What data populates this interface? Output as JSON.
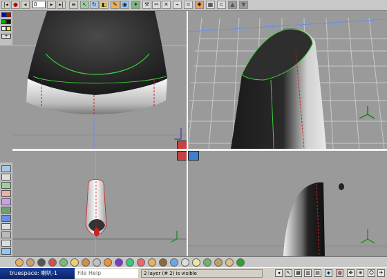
{
  "app": {
    "title": "truespace: 喇叭-1",
    "frame_value": "0",
    "status_text": "2 layer (# 2) is visible"
  },
  "menu": {
    "file": "File",
    "help": "Help"
  },
  "toolbar": {
    "buttons": [
      "rewind-icon",
      "record-icon",
      "prev-frame-icon",
      "play-icon",
      "next-frame-icon",
      "end-icon",
      "object-list-icon",
      "select-icon",
      "rotate-icon",
      "scale-icon",
      "move-icon",
      "paint-icon",
      "render-icon",
      "wrench-icon",
      "cut-icon",
      "scissors-icon",
      "wand-icon",
      "deform-icon",
      "grid-icon",
      "up-arrow-icon",
      "down-arrow-icon"
    ]
  },
  "palette_colors": [
    "#0000cc",
    "#cc0000",
    "#00aa00",
    "#111111",
    "#ffffff",
    "#ffff00"
  ],
  "accent": {
    "grid_line": "#c9c9c9",
    "axis_blue": "#4a6ee0",
    "spline_green": "#3ecf3e",
    "edge_red": "#cc2020"
  }
}
